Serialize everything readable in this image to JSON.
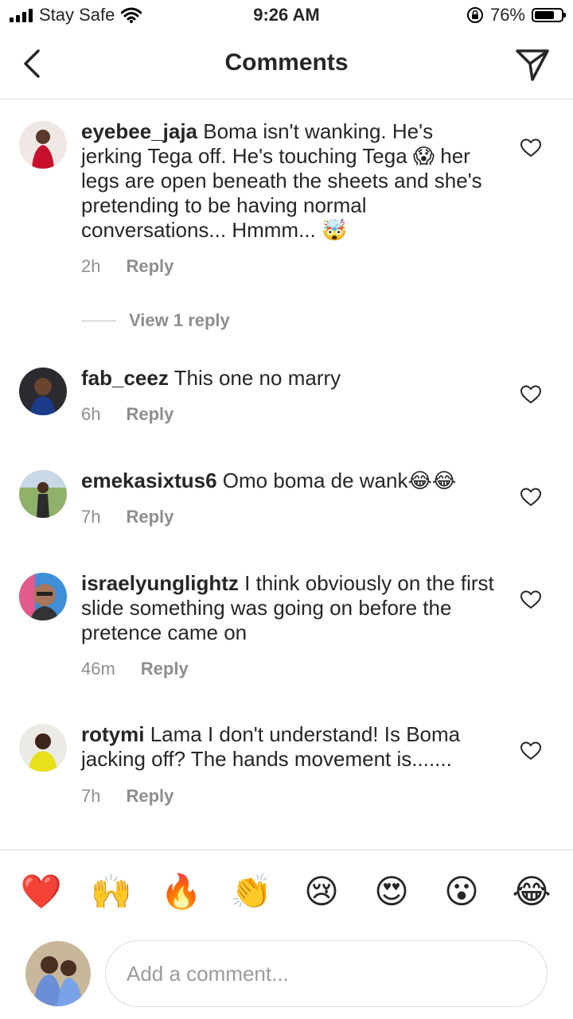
{
  "status_bar": {
    "carrier": "Stay Safe",
    "time": "9:26 AM",
    "battery": "76%",
    "battery_level": 0.76
  },
  "header": {
    "title": "Comments",
    "back_icon": "chevron-left-icon",
    "share_icon": "paper-plane-icon"
  },
  "comments": [
    {
      "username": "eyebee_jaja",
      "text": "Boma isn't wanking. He's jerking Tega off. He's touching Tega 😱 her legs are open beneath the sheets and she's pretending to be having normal conversations... Hmmm... 🤯",
      "time": "2h",
      "reply": "Reply",
      "view_replies": "View 1 reply"
    },
    {
      "username": "fab_ceez",
      "text": "This one no marry",
      "time": "6h",
      "reply": "Reply"
    },
    {
      "username": "emekasixtus6",
      "text": "Omo boma de wank😂😂",
      "time": "7h",
      "reply": "Reply"
    },
    {
      "username": "israelyunglightz",
      "text": "I think obviously on the first slide something was going on before the pretence came on",
      "time": "46m",
      "reply": "Reply"
    },
    {
      "username": "rotymi",
      "text": "Lama I don't understand! Is Boma jacking off? The hands movement is.......",
      "time": "7h",
      "reply": "Reply"
    }
  ],
  "reactions": [
    "❤️",
    "🙌",
    "🔥",
    "👏",
    "😢",
    "😍",
    "😮",
    "😂"
  ],
  "composer": {
    "placeholder": "Add a comment..."
  }
}
